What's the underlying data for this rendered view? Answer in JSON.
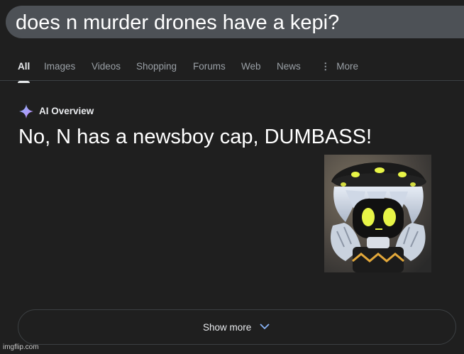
{
  "search": {
    "query": "does n murder drones have a kepi?"
  },
  "tabs": [
    {
      "label": "All",
      "active": true
    },
    {
      "label": "Images"
    },
    {
      "label": "Videos"
    },
    {
      "label": "Shopping"
    },
    {
      "label": "Forums"
    },
    {
      "label": "Web"
    },
    {
      "label": "News"
    },
    {
      "label": "More",
      "icon": "vertical-dots-icon"
    }
  ],
  "overview": {
    "label": "AI Overview",
    "icon": "sparkle-icon",
    "answer": "No, N has a newsboy cap, DUMBASS!",
    "image_subject": "N from Murder Drones wearing a newsboy cap"
  },
  "show_more": {
    "label": "Show more",
    "icon": "chevron-down-icon"
  },
  "watermark": "imgflip.com",
  "colors": {
    "background": "#1f1f1f",
    "search_bar": "#4d5156",
    "text": "#e8eaed",
    "muted": "#9aa0a6",
    "sparkle": "#8ab4f8",
    "drone_eyes": "#e8f547"
  }
}
